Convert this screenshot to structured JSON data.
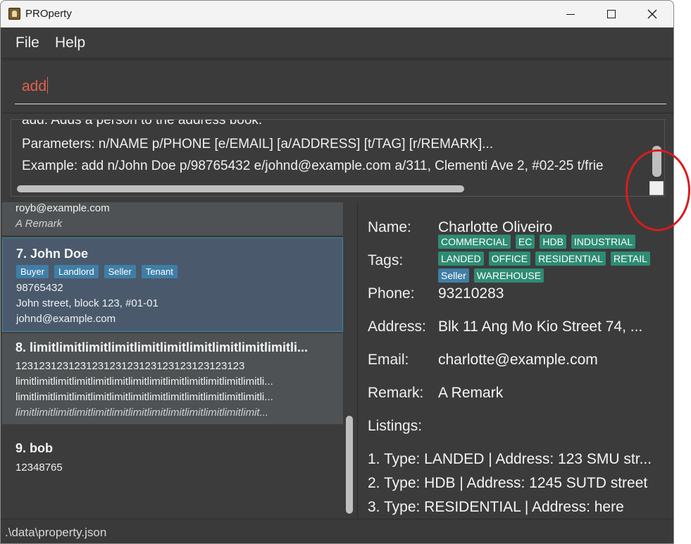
{
  "window": {
    "title": "PROperty"
  },
  "menu": {
    "file": "File",
    "help": "Help"
  },
  "command": {
    "value": "add"
  },
  "result": {
    "line1": "add: Adds a person to the address book.",
    "line2": "Parameters: n/NAME p/PHONE [e/EMAIL] [a/ADDRESS] [t/TAG] [r/REMARK]...",
    "line3": "Example: add n/John Doe p/98765432 e/johnd@example.com a/311, Clementi Ave 2, #02-25 t/frie"
  },
  "list": {
    "partial": {
      "email": "royb@example.com",
      "remark": "A Remark"
    },
    "card7": {
      "name": "7. John Doe",
      "tags": [
        "Buyer",
        "Landlord",
        "Seller",
        "Tenant"
      ],
      "phone": "98765432",
      "address": "John street, block 123, #01-01",
      "email": "johnd@example.com"
    },
    "card8": {
      "name": "8. limitlimitlimitlimitlimitlimitlimitlimitlimitlimitli...",
      "phone": "123123123123123123123123123123123123123",
      "line2": "limitlimitlimitlimitlimitlimitlimitlimitlimitlimitlimitlimitlimitli...",
      "line3": "limitlimitlimitlimitlimitlimitlimitlimitlimitlimitlimitlimitlimitli...",
      "line4": "limitlimitlimitlimitlimitlimitlimitlimitlimitlimitlimitlimitlimit..."
    },
    "card9": {
      "name": "9. bob",
      "phone": "12348765"
    }
  },
  "detail": {
    "labels": {
      "name": "Name:",
      "tags": "Tags:",
      "phone": "Phone:",
      "address": "Address:",
      "email": "Email:",
      "remark": "Remark:",
      "listings": "Listings:"
    },
    "name": "Charlotte Oliveiro",
    "tags_green": [
      "COMMERCIAL",
      "EC",
      "HDB",
      "INDUSTRIAL",
      "LANDED",
      "OFFICE",
      "RESIDENTIAL",
      "RETAIL"
    ],
    "tag_blue": "Seller",
    "tag_last": "WAREHOUSE",
    "phone": "93210283",
    "address": "Blk 11 Ang Mo Kio Street 74, ...",
    "email": "charlotte@example.com",
    "remark": "A Remark",
    "listings": [
      "1. Type: LANDED | Address: 123 SMU str...",
      "2. Type: HDB | Address: 1245 SUTD street",
      "3. Type: RESIDENTIAL | Address: here"
    ]
  },
  "status": {
    "path": ".\\data\\property.json"
  },
  "colors": {
    "accent_text": "#e0614d",
    "tag_green": "#2e8b74",
    "tag_blue": "#3f7ea6",
    "annotation": "#d91c1c"
  }
}
